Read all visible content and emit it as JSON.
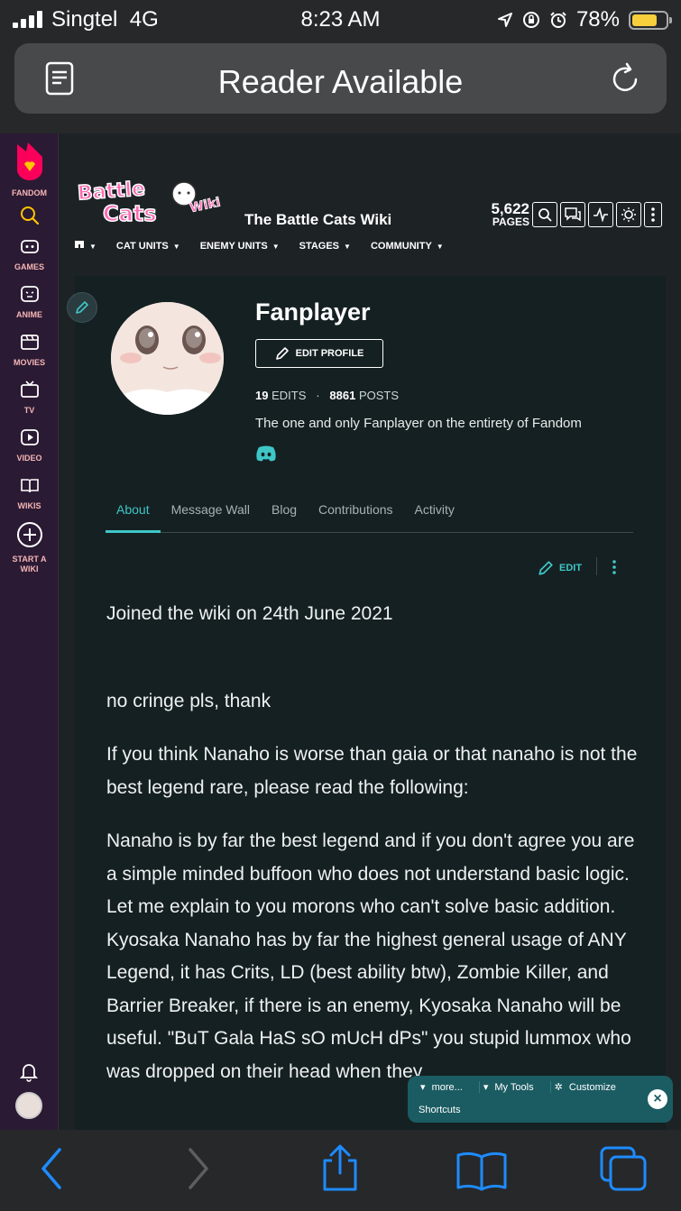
{
  "status": {
    "carrier": "Singtel",
    "network": "4G",
    "time": "8:23 AM",
    "battery": "78%"
  },
  "browser": {
    "reader_label": "Reader Available"
  },
  "rail": {
    "items": [
      {
        "label": "FANDOM"
      },
      {
        "label": "GAMES"
      },
      {
        "label": "ANIME"
      },
      {
        "label": "MOVIES"
      },
      {
        "label": "TV"
      },
      {
        "label": "VIDEO"
      },
      {
        "label": "WIKIS"
      },
      {
        "label": "START A WIKI"
      }
    ]
  },
  "wiki": {
    "title": "The Battle Cats Wiki",
    "logo_text": "The Battle Cats Wiki",
    "page_count": "5,622",
    "page_label": "PAGES",
    "nav": [
      "CAT UNITS",
      "ENEMY UNITS",
      "STAGES",
      "COMMUNITY"
    ]
  },
  "profile": {
    "username": "Fanplayer",
    "edit_profile": "EDIT PROFILE",
    "edits_count": "19",
    "edits_label": "EDITS",
    "posts_count": "8861",
    "posts_label": "POSTS",
    "bio": "The one and only Fanplayer on the entirety of Fandom"
  },
  "tabs": [
    "About",
    "Message Wall",
    "Blog",
    "Contributions",
    "Activity"
  ],
  "active_tab": "About",
  "edit_label": "EDIT",
  "article": {
    "p1": "Joined the wiki on 24th June 2021",
    "p2": "no cringe pls, thank",
    "p3": "If you think Nanaho is worse than gaia or that nanaho is not the best legend rare, please read the following:",
    "p4": "Nanaho is by far the best legend and if you don't agree you are a simple minded buffoon who does not understand basic logic. Let me explain to you morons who can't solve basic addition. Kyosaka Nanaho has by far the highest general usage of ANY Legend, it has Crits, LD (best ability btw), Zombie Killer, and Barrier Breaker, if there is an enemy, Kyosaka Nanaho will be useful. \"BuT Gala HaS sO mUcH dPs\" you stupid lummox who was dropped on their head when they"
  },
  "tools": {
    "more": "more...",
    "my_tools": "My Tools",
    "customize": "Customize",
    "shortcuts": "Shortcuts"
  },
  "colors": {
    "accent": "#3fc6c7",
    "rail": "#2b1a33",
    "fandom": "#fa005a",
    "tools_bg": "#1b5c62"
  }
}
